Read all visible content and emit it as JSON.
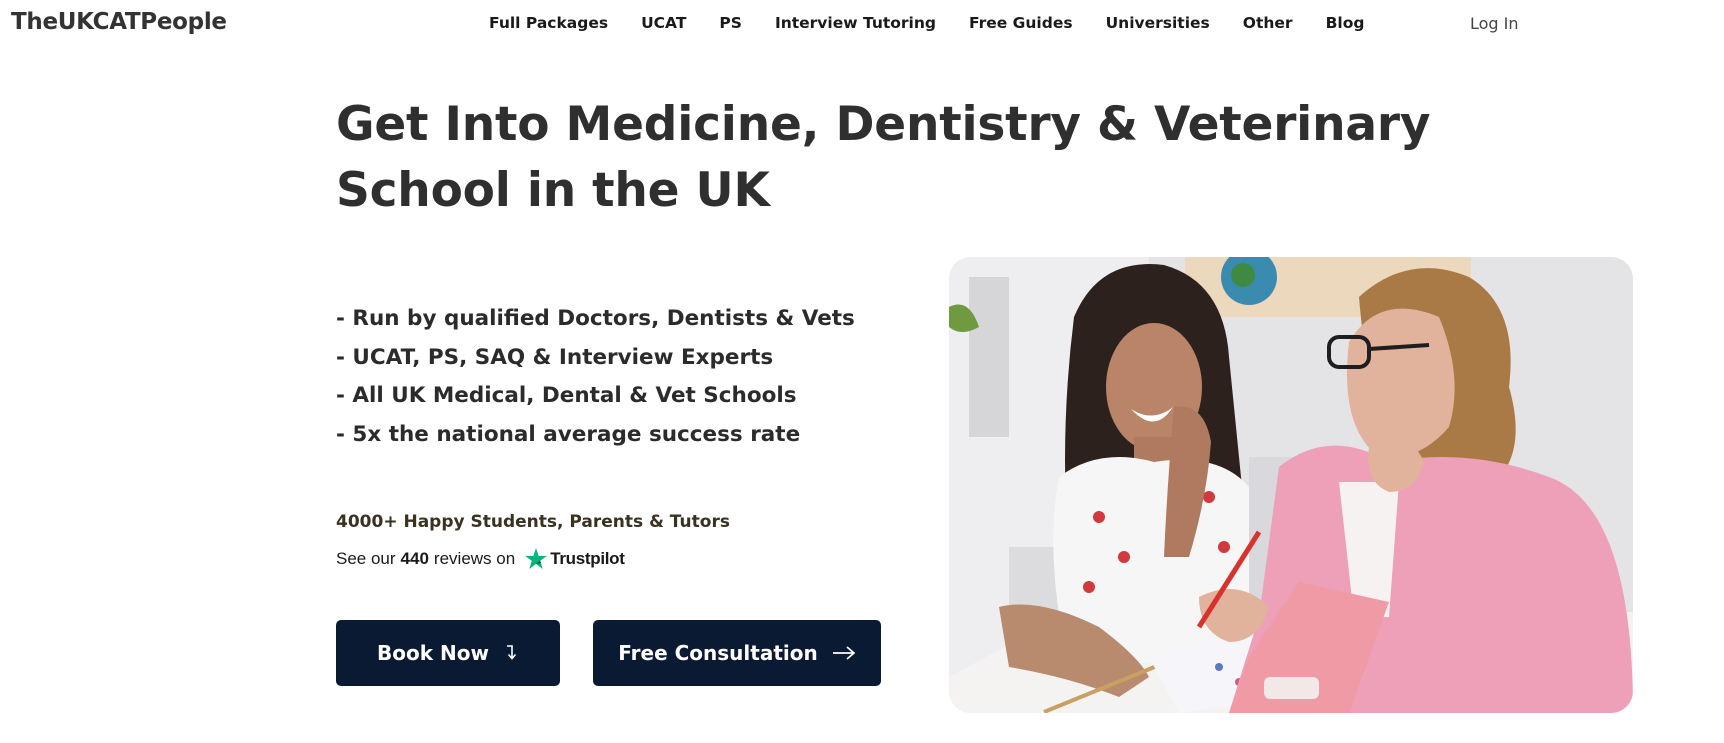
{
  "header": {
    "logo": "TheUKCATPeople",
    "nav": [
      {
        "label": "Full Packages"
      },
      {
        "label": "UCAT"
      },
      {
        "label": "PS"
      },
      {
        "label": "Interview Tutoring"
      },
      {
        "label": "Free Guides"
      },
      {
        "label": "Universities"
      },
      {
        "label": "Other"
      },
      {
        "label": "Blog"
      }
    ],
    "login": "Log In"
  },
  "hero": {
    "title_line1": "Get Into Medicine, Dentistry & Veterinary",
    "title_line2": "School in the UK",
    "bullets": [
      "- Run by qualified Doctors, Dentists & Vets",
      "- UCAT, PS, SAQ & Interview Experts",
      "- All UK Medical, Dental & Vet Schools",
      "- 5x the national average success rate"
    ],
    "happy": "4000+ Happy Students, Parents & Tutors",
    "reviews_prefix": "See our",
    "reviews_count": "440",
    "reviews_suffix": "reviews on",
    "trustpilot": "Trustpilot",
    "book_label": "Book Now",
    "book_icon": "arrow-down-right-icon",
    "consult_label": "Free Consultation",
    "consult_icon": "arrow-right-icon"
  },
  "colors": {
    "button_bg": "#0b1a33",
    "trustpilot_green": "#00b67a",
    "text_dark": "#2f2f2f"
  }
}
